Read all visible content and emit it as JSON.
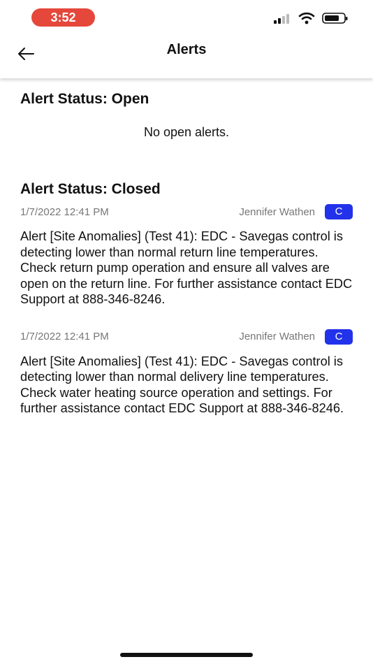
{
  "status_bar": {
    "time": "3:52"
  },
  "header": {
    "title": "Alerts"
  },
  "open_section": {
    "title": "Alert Status: Open",
    "empty_message": "No open alerts."
  },
  "closed_section": {
    "title": "Alert Status: Closed",
    "alerts": [
      {
        "date": "1/7/2022 12:41 PM",
        "user": "Jennifer Wathen",
        "badge": "C",
        "text": "Alert [Site Anomalies] (Test 41): EDC - Savegas control is detecting lower than normal return line temperatures. Check return pump operation and ensure all valves are open on the return line. For further assistance contact EDC Support at 888-346-8246."
      },
      {
        "date": "1/7/2022 12:41 PM",
        "user": "Jennifer Wathen",
        "badge": "C",
        "text": "Alert [Site Anomalies] (Test 41): EDC - Savegas control is detecting lower than normal delivery line temperatures. Check water heating source operation and settings. For further assistance contact EDC Support at 888-346-8246."
      }
    ]
  },
  "colors": {
    "time_pill": "#e5473b",
    "badge": "#2232ea"
  }
}
